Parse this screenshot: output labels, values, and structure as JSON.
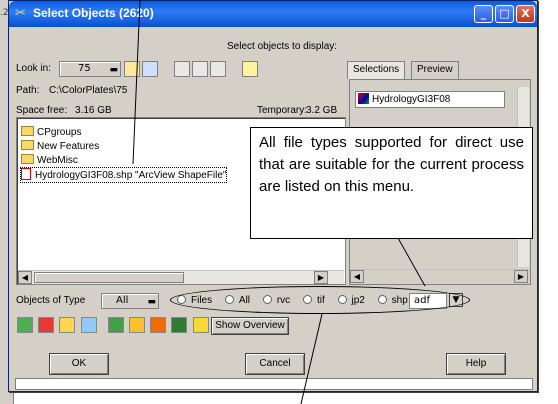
{
  "background": {
    "left_label": ".2"
  },
  "window": {
    "title": "Select Objects (2620)",
    "icon": "crossed-tools-icon",
    "controls": [
      "_",
      "□",
      "X"
    ]
  },
  "header": {
    "instruction": "Select objects to display:"
  },
  "lookin": {
    "label": "Look in:",
    "value": "75"
  },
  "path": {
    "label": "Path:",
    "value": "C:\\ColorPlates\\75"
  },
  "space": {
    "label": "Space free:",
    "value": "3.16 GB",
    "temp_label": "Temporary:",
    "temp_value": "3.2 GB"
  },
  "files": [
    {
      "name": "CPgroups",
      "type": "folder"
    },
    {
      "name": "New Features",
      "type": "folder"
    },
    {
      "name": "WebMisc",
      "type": "folder"
    },
    {
      "name": "HydrologyGI3F08.shp  \"ArcView ShapeFile\"",
      "type": "file"
    }
  ],
  "tabs": {
    "selections": "Selections",
    "preview": "Preview"
  },
  "selections": [
    "HydrologyGI3F08"
  ],
  "object_type": {
    "label": "Objects of Type",
    "value": "All"
  },
  "filters": {
    "files_label": "Files",
    "options": [
      "All",
      "rvc",
      "tif",
      "jp2",
      "shp"
    ],
    "dropdown_value": "adf"
  },
  "toolbar": {
    "show_overview": "Show Overview"
  },
  "buttons": {
    "ok": "OK",
    "cancel": "Cancel",
    "help": "Help"
  },
  "callout": {
    "text": "All file types supported for direct use that are suitable for the current process are listed on this menu."
  },
  "colors": {
    "titlebar": "#0a5be0",
    "dialog": "#d4d0c8",
    "accent_close": "#c2341e"
  }
}
